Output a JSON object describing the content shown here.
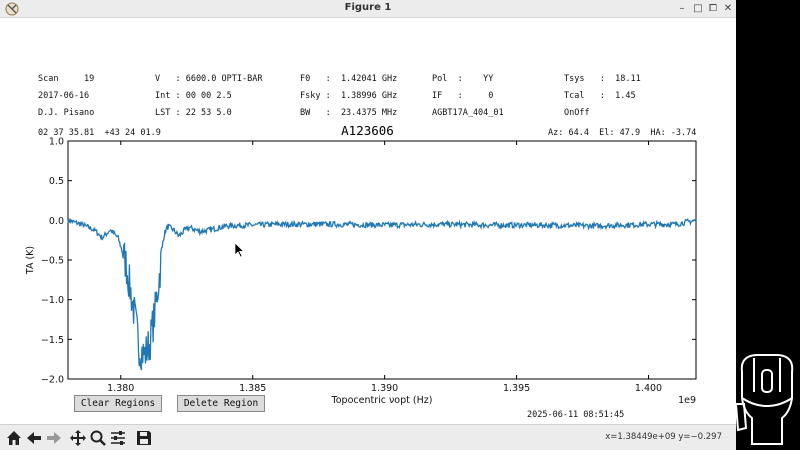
{
  "window": {
    "title": "Figure 1",
    "controls": {
      "minimize": "–",
      "restore": "□",
      "maximize": "⧠",
      "close": "✕"
    }
  },
  "header": {
    "rows": [
      [
        "Scan     19",
        "V   : 6600.0 OPTI-BAR",
        "F0   :  1.42041 GHz",
        "Pol  :    YY",
        "Tsys   :  18.11"
      ],
      [
        "2017-06-16",
        "Int : 00 00 2.5",
        "Fsky :  1.38996 GHz",
        "IF   :     0",
        "Tcal   :  1.45"
      ],
      [
        "D.J. Pisano",
        "LST : 22 53 5.0",
        "BW   :  23.4375 MHz",
        "AGBT17A_404_01",
        "OnOff"
      ]
    ],
    "coords": "02 37 35.81  +43 24 01.9",
    "source": "A123606",
    "azelha": "Az: 64.4  El: 47.9  HA: -3.74"
  },
  "buttons": {
    "clear_regions": "Clear Regions",
    "delete_region": "Delete Region"
  },
  "timestamp": "2025-06-11 08:51:45",
  "toolbar": {
    "icons": [
      "home-icon",
      "back-icon",
      "forward-icon",
      "pan-icon",
      "zoom-icon",
      "configure-icon",
      "save-icon"
    ],
    "coords_readout": "x=1.38449e+09 y=−0.297"
  },
  "chart_data": {
    "type": "line",
    "xlabel": "Topocentric νopt (Hz)",
    "ylabel": "TA (K)",
    "x_offset_label": "1e9",
    "xlim": [
      1.378,
      1.4018
    ],
    "ylim": [
      -2.0,
      1.0
    ],
    "xticks": [
      1.38,
      1.385,
      1.39,
      1.395,
      1.4
    ],
    "xtick_labels": [
      "1.380",
      "1.385",
      "1.390",
      "1.395",
      "1.400"
    ],
    "yticks": [
      1.0,
      0.5,
      0.0,
      -0.5,
      -1.0,
      -1.5,
      -2.0
    ],
    "ytick_labels": [
      "1.0",
      "0.5",
      "0.0",
      "−0.5",
      "−1.0",
      "−1.5",
      "−2.0"
    ],
    "color": "#1f77b4",
    "series": [
      {
        "x": [
          1.378,
          1.3785,
          1.379,
          1.3793,
          1.3796,
          1.3799,
          1.3802,
          1.3805,
          1.3807,
          1.3809,
          1.3811,
          1.3813,
          1.3815,
          1.3816,
          1.3817,
          1.3818,
          1.382,
          1.3822,
          1.3824,
          1.3826,
          1.383,
          1.3834,
          1.384,
          1.385,
          1.386,
          1.388,
          1.39,
          1.392,
          1.394,
          1.396,
          1.398,
          1.4,
          1.401,
          1.4018
        ],
        "y": [
          0.0,
          -0.05,
          -0.12,
          -0.22,
          -0.12,
          -0.22,
          -0.55,
          -1.15,
          -1.6,
          -1.7,
          -1.55,
          -1.15,
          -0.6,
          -0.25,
          -0.12,
          -0.08,
          -0.12,
          -0.2,
          -0.13,
          -0.09,
          -0.14,
          -0.12,
          -0.07,
          -0.06,
          -0.05,
          -0.05,
          -0.06,
          -0.05,
          -0.06,
          -0.06,
          -0.07,
          -0.05,
          -0.05,
          0.0
        ]
      }
    ]
  }
}
